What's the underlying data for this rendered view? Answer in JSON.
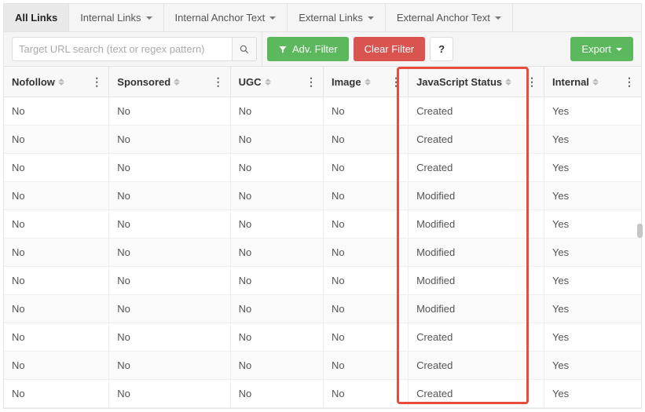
{
  "tabs": [
    {
      "label": "All Links",
      "active": true,
      "caret": false
    },
    {
      "label": "Internal Links",
      "active": false,
      "caret": true
    },
    {
      "label": "Internal Anchor Text",
      "active": false,
      "caret": true
    },
    {
      "label": "External Links",
      "active": false,
      "caret": true
    },
    {
      "label": "External Anchor Text",
      "active": false,
      "caret": true
    }
  ],
  "toolbar": {
    "search_placeholder": "Target URL search (text or regex pattern)",
    "adv_filter_label": "Adv. Filter",
    "clear_filter_label": "Clear Filter",
    "help_label": "?",
    "export_label": "Export"
  },
  "columns": [
    "Nofollow",
    "Sponsored",
    "UGC",
    "Image",
    "JavaScript Status",
    "Internal"
  ],
  "rows": [
    {
      "nofollow": "No",
      "sponsored": "No",
      "ugc": "No",
      "image": "No",
      "js": "Created",
      "internal": "Yes"
    },
    {
      "nofollow": "No",
      "sponsored": "No",
      "ugc": "No",
      "image": "No",
      "js": "Created",
      "internal": "Yes"
    },
    {
      "nofollow": "No",
      "sponsored": "No",
      "ugc": "No",
      "image": "No",
      "js": "Created",
      "internal": "Yes"
    },
    {
      "nofollow": "No",
      "sponsored": "No",
      "ugc": "No",
      "image": "No",
      "js": "Modified",
      "internal": "Yes"
    },
    {
      "nofollow": "No",
      "sponsored": "No",
      "ugc": "No",
      "image": "No",
      "js": "Modified",
      "internal": "Yes"
    },
    {
      "nofollow": "No",
      "sponsored": "No",
      "ugc": "No",
      "image": "No",
      "js": "Modified",
      "internal": "Yes"
    },
    {
      "nofollow": "No",
      "sponsored": "No",
      "ugc": "No",
      "image": "No",
      "js": "Modified",
      "internal": "Yes"
    },
    {
      "nofollow": "No",
      "sponsored": "No",
      "ugc": "No",
      "image": "No",
      "js": "Modified",
      "internal": "Yes"
    },
    {
      "nofollow": "No",
      "sponsored": "No",
      "ugc": "No",
      "image": "No",
      "js": "Created",
      "internal": "Yes"
    },
    {
      "nofollow": "No",
      "sponsored": "No",
      "ugc": "No",
      "image": "No",
      "js": "Created",
      "internal": "Yes"
    },
    {
      "nofollow": "No",
      "sponsored": "No",
      "ugc": "No",
      "image": "No",
      "js": "Created",
      "internal": "Yes"
    }
  ],
  "highlight_column": "JavaScript Status"
}
